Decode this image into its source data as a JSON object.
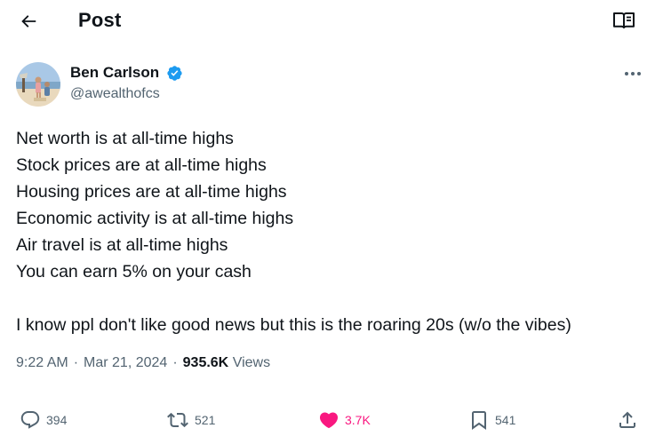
{
  "header": {
    "back_icon": "arrow-left-icon",
    "title": "Post",
    "reader_icon": "open-book-icon"
  },
  "author": {
    "name": "Ben Carlson",
    "handle": "@awealthofcs",
    "verified": true,
    "verified_color": "#1d9bf0",
    "more_icon": "ellipsis-icon"
  },
  "tweet": {
    "lines": [
      "Net worth is at all-time highs",
      "Stock prices are at all-time highs",
      "Housing prices are at all-time highs",
      "Economic activity is at all-time highs",
      "Air travel is at all-time highs",
      "You can earn 5% on your cash"
    ],
    "closing": "I know ppl don't like good news but this is the roaring 20s (w/o the vibes)"
  },
  "meta": {
    "time": "9:22 AM",
    "date": "Mar 21, 2024",
    "separator": "·",
    "views_count": "935.6K",
    "views_label": "Views"
  },
  "actions": {
    "reply": {
      "icon": "reply-bubble-icon",
      "count": "394"
    },
    "repost": {
      "icon": "repost-icon",
      "count": "521"
    },
    "like": {
      "icon": "heart-filled-icon",
      "count": "3.7K",
      "color": "#f91880"
    },
    "bookmark": {
      "icon": "bookmark-icon",
      "count": "541"
    },
    "share": {
      "icon": "share-upload-icon"
    }
  },
  "colors": {
    "text": "#0f1419",
    "secondary": "#536471",
    "accent": "#1d9bf0",
    "like": "#f91880"
  }
}
